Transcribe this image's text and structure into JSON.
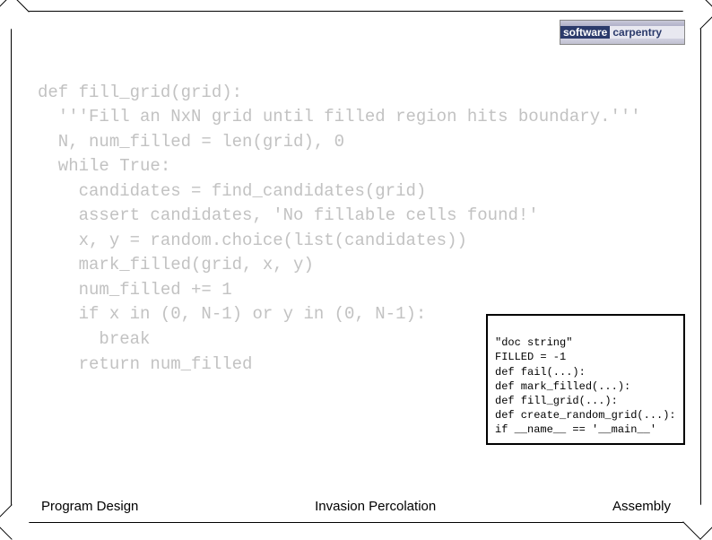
{
  "logo": {
    "top": "",
    "software": "software",
    "carpentry": "carpentry",
    "bottom": ""
  },
  "code": {
    "line1": "def fill_grid(grid):",
    "line2": "  '''Fill an NxN grid until filled region hits boundary.'''",
    "line3": "  N, num_filled = len(grid), 0",
    "line4": "  while True:",
    "line5": "    candidates = find_candidates(grid)",
    "line6": "    assert candidates, 'No fillable cells found!'",
    "line7": "    x, y = random.choice(list(candidates))",
    "line8": "    mark_filled(grid, x, y)",
    "line9": "    num_filled += 1",
    "line10": "    if x in (0, N-1) or y in (0, N-1):",
    "line11": "      break",
    "line12": "    return num_filled"
  },
  "outline": {
    "l1": "\"doc string\"",
    "l2": "FILLED = -1",
    "l3": "def fail(...):",
    "l4": "def mark_filled(...):",
    "l5": "def fill_grid(...):",
    "l6": "def create_random_grid(...):",
    "l7": "if __name__ == '__main__'"
  },
  "footer": {
    "left": "Program Design",
    "center": "Invasion Percolation",
    "right": "Assembly"
  }
}
